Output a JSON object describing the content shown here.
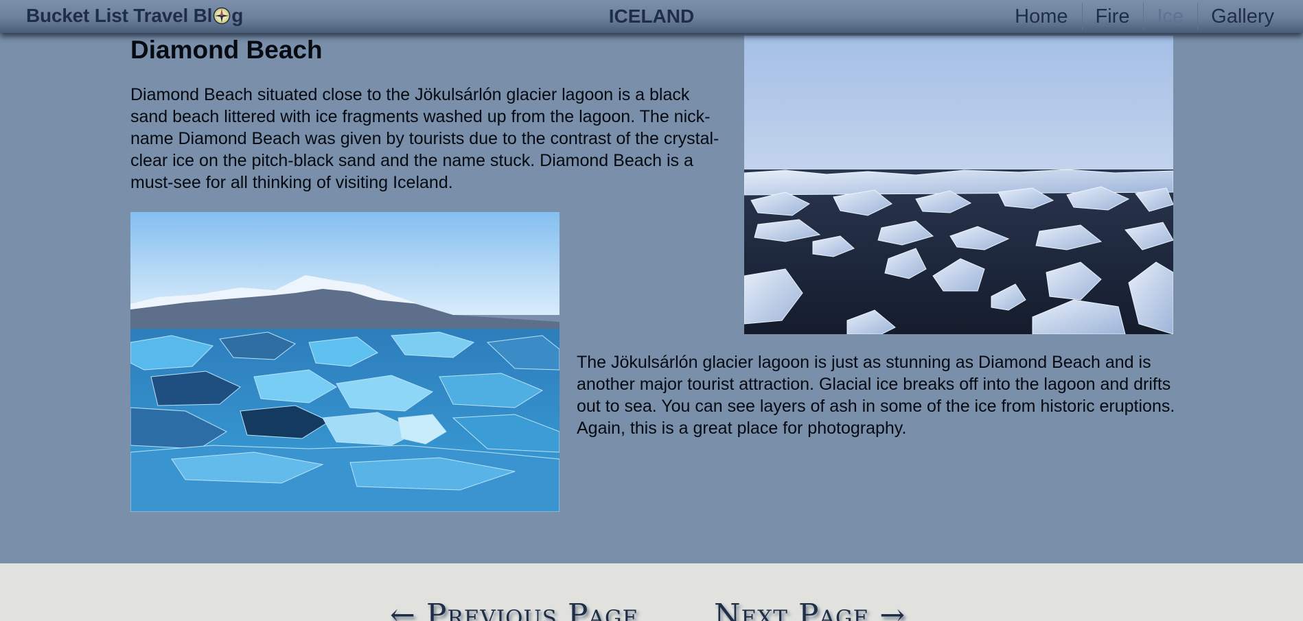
{
  "header": {
    "brand_before": "Bucket List Travel Bl",
    "brand_after": "g",
    "title": "ICELAND",
    "nav": [
      {
        "label": "Home",
        "active": false
      },
      {
        "label": "Fire",
        "active": false
      },
      {
        "label": "Ice",
        "active": true
      },
      {
        "label": "Gallery",
        "active": false
      }
    ]
  },
  "main": {
    "heading": "Diamond Beach",
    "paragraph_1": "Diamond Beach situated close to the Jökulsárlón glacier lagoon is a black sand beach littered with ice fragments washed up from the lagoon. The nick-name Diamond Beach was given by tourists due to the contrast of the crystal-clear ice on the pitch-black sand and the name stuck. Diamond Beach is a must-see for all thinking of visiting Iceland.",
    "paragraph_2": "The Jökulsárlón glacier lagoon is just as stunning as Diamond Beach and is another major tourist attraction. Glacial ice breaks off into the lagoon and drifts out to sea. You can see layers of ash in some of the ice from historic eruptions. Again, this is a great place for photography."
  },
  "footer": {
    "previous_label": "← Previous Page",
    "next_label": "Next Page →"
  },
  "colors": {
    "page_background": "#7a8fa9",
    "header_text": "#1f2e47",
    "nav_active": "#5f7391",
    "footer_background": "#e1e2de"
  },
  "icons": {
    "brand_o": "compass-icon"
  }
}
